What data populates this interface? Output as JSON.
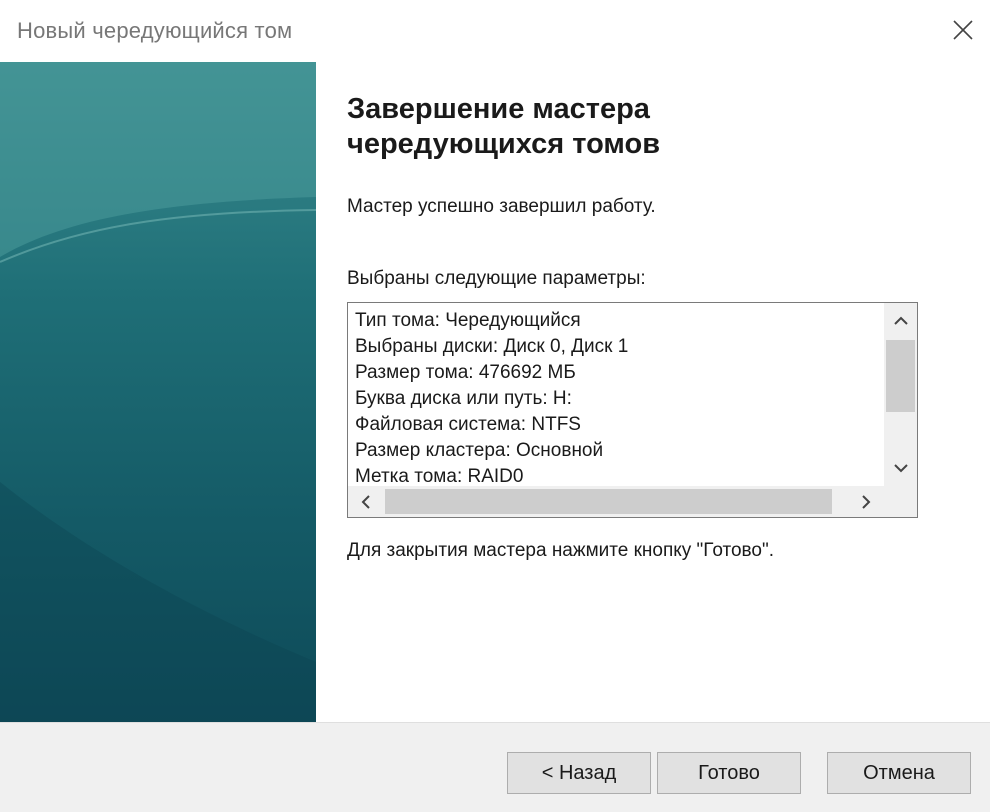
{
  "window": {
    "title": "Новый чередующийся том",
    "close_icon": "close-icon"
  },
  "wizard": {
    "heading_line1": "Завершение мастера",
    "heading_line2": "чередующихся томов",
    "success_text": "Мастер успешно завершил работу.",
    "params_label": "Выбраны следующие параметры:",
    "params": [
      "Тип тома: Чередующийся",
      "Выбраны диски: Диск 0, Диск 1",
      "Размер тома: 476692 МБ",
      "Буква диска или путь: H:",
      "Файловая система: NTFS",
      "Размер кластера: Основной",
      "Метка тома: RAID0"
    ],
    "close_hint": "Для закрытия мастера нажмите кнопку \"Готово\"."
  },
  "buttons": {
    "back": "< Назад",
    "finish": "Готово",
    "cancel": "Отмена"
  },
  "colors": {
    "side_panel_top": "#3b8c8f",
    "side_panel_bottom": "#0e4a58",
    "footer_bg": "#f0f0f0"
  }
}
